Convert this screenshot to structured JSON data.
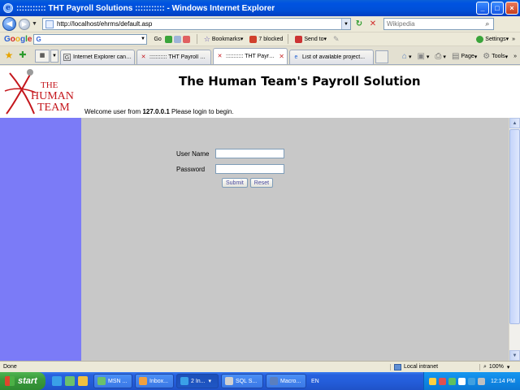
{
  "window": {
    "title": "::::::::::: THT Payroll Solutions ::::::::::: - Windows Internet Explorer",
    "minimize": "_",
    "maximize": "□",
    "close": "×"
  },
  "address_bar": {
    "url": "http://localhost/ehrms/default.asp",
    "search_placeholder": "Wikipedia"
  },
  "google_toolbar": {
    "logo": "Google",
    "search_prefix": "G",
    "go_label": "Go",
    "bookmarks_label": "Bookmarks",
    "blocked_label": "7 blocked",
    "send_to_label": "Send to",
    "settings_label": "Settings"
  },
  "tabs": [
    {
      "label": "Internet Explorer cann...",
      "active": false
    },
    {
      "label": "::::::::::: THT Payroll So...",
      "active": false
    },
    {
      "label": "::::::::::: THT Payro...",
      "active": true
    },
    {
      "label": "List of available project...",
      "active": false
    }
  ],
  "command_bar": {
    "page_label": "Page",
    "tools_label": "Tools"
  },
  "page": {
    "logo": {
      "line1": "THE",
      "line2": "HUMAN",
      "line3": "TEAM"
    },
    "app_title": "The Human Team's Payroll Solution",
    "welcome_prefix": "Welcome user from",
    "welcome_ip": "127.0.0.1",
    "welcome_suffix": "Please login to begin.",
    "login": {
      "username_label": "User Name",
      "password_label": "Password",
      "username_value": "",
      "password_value": "",
      "submit_label": "Submit",
      "reset_label": "Reset"
    }
  },
  "status_bar": {
    "status": "Done",
    "zone": "Local intranet",
    "zoom": "100%"
  },
  "taskbar": {
    "start_label": "start",
    "buttons": [
      {
        "label": "MSN ...",
        "active": false
      },
      {
        "label": "Inbox...",
        "active": false
      },
      {
        "label": "2 In...",
        "active": true
      },
      {
        "label": "SQL S...",
        "active": false
      },
      {
        "label": "Macro...",
        "active": false
      }
    ],
    "language": "EN",
    "clock": "12:14 PM"
  },
  "colors": {
    "left_panel": "#7b7bf7",
    "content_background": "#c8c8c8",
    "logo_red": "#c4161c",
    "button_text": "#4a4a9e"
  }
}
